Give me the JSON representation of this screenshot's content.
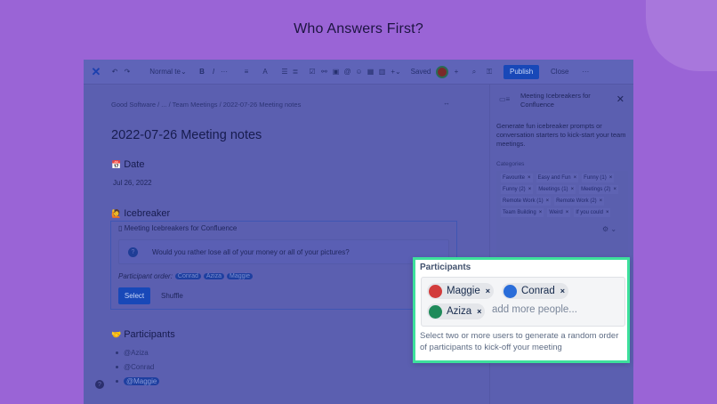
{
  "page": {
    "heading": "Who Answers First?"
  },
  "toolbar": {
    "undo_icon": "undo-icon",
    "redo_icon": "redo-icon",
    "text_style": "Normal te",
    "bold": "B",
    "italic": "I",
    "more": "···",
    "list": "≡",
    "color": "A",
    "bullets": "☰",
    "numbered": "≣",
    "task": "☑",
    "link": "⚯",
    "image": "▣",
    "mention": "@",
    "emoji": "☺",
    "table": "▦",
    "layout": "▥",
    "insert": "+",
    "status": "Saved",
    "publish": "Publish",
    "close": "Close",
    "overflow": "···",
    "add_collaborator": "+",
    "search_icon": "⌕",
    "restrictions_icon": "⚿"
  },
  "breadcrumb": "Good Software  /  ...  /  Team Meetings  /  2022-07-26 Meeting notes",
  "expand": "↔",
  "document": {
    "title": "2022-07-26 Meeting notes",
    "date_heading": "Date",
    "date_value": "Jul 26, 2022",
    "icebreaker_heading": "Icebreaker",
    "icebreaker_box_title": "Meeting Icebreakers for Confluence",
    "question": "Would you rather lose all of your money or all of your pictures?",
    "order_label": "Participant order:",
    "order": [
      "Conrad",
      "Aziza",
      "Maggie"
    ],
    "select_button": "Select",
    "shuffle_button": "Shuffle",
    "participants_heading": "Participants",
    "participants": [
      "@Aziza",
      "@Conrad",
      "@Maggie"
    ],
    "help": "?"
  },
  "sidebar": {
    "title": "Meeting Icebreakers for Confluence",
    "close": "✕",
    "description": "Generate fun icebreaker prompts or conversation starters to kick-start your team meetings.",
    "categories_label": "Categories",
    "categories": [
      "Favourite",
      "Easy and Fun",
      "Funny (1)",
      "Funny (2)",
      "Meetings (1)",
      "Meetings (2)",
      "Remote Work (1)",
      "Remote Work (2)",
      "Team Building",
      "Weird",
      "If you could"
    ],
    "category_remove": "×",
    "settings": "⚙ ⌄"
  },
  "popup": {
    "title": "Participants",
    "chips": [
      {
        "name": "Maggie",
        "avatar_color": "#d23c3c"
      },
      {
        "name": "Conrad",
        "avatar_color": "#2a6dd9"
      },
      {
        "name": "Aziza",
        "avatar_color": "#1f8a5a"
      }
    ],
    "chip_remove": "×",
    "placeholder": "add more people...",
    "help_text": "Select two or more users to generate a random order of participants to kick-off your meeting"
  },
  "colors": {
    "background": "#9a64d6",
    "highlight_border": "#3de09c",
    "publish": "#1848b8"
  }
}
